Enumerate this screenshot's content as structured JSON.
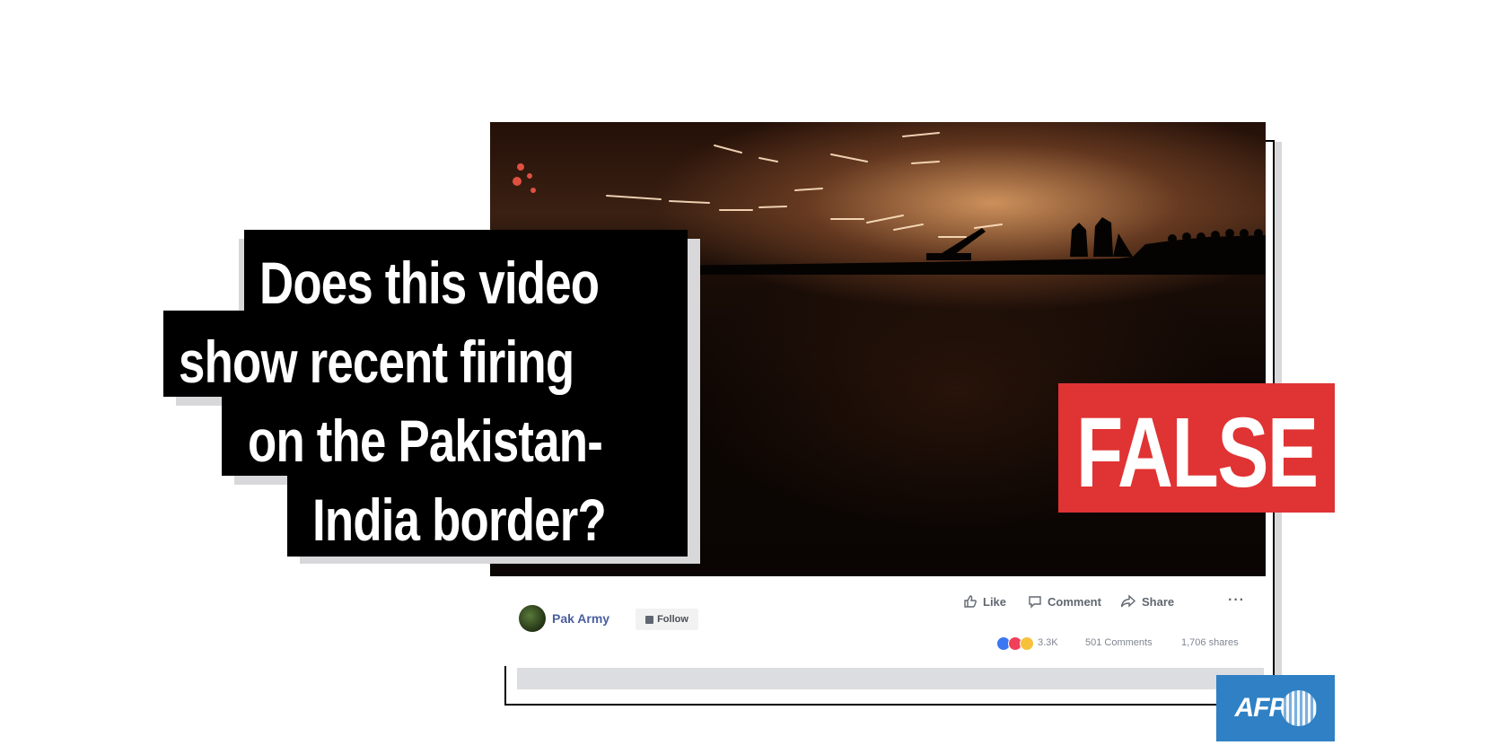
{
  "headline": {
    "lines": [
      "Does this video",
      "show recent firing",
      "on the Pakistan-",
      "India border?"
    ]
  },
  "verdict": {
    "label": "FALSE",
    "color": "#e03333"
  },
  "post": {
    "page_name": "Pak Army",
    "follow_label": "Follow",
    "actions": {
      "like": "Like",
      "comment": "Comment",
      "share": "Share",
      "more": "···"
    },
    "reactions_count": "3.3K",
    "comments_count": "501 Comments",
    "shares_count": "1,706 shares",
    "reaction_icons": [
      "like-icon",
      "love-icon",
      "sad-icon"
    ]
  },
  "logo": {
    "text": "AFP",
    "color": "#2f80c4"
  }
}
